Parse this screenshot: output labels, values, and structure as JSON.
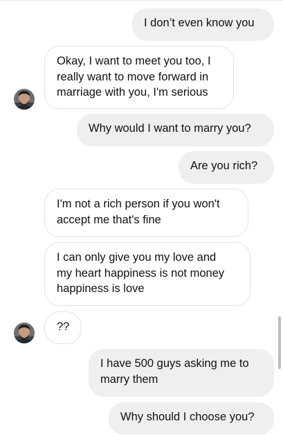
{
  "conversation": {
    "messages": [
      {
        "from": "me",
        "text": "I don’t even know you"
      },
      {
        "from": "them",
        "text": "Okay, I want to meet you too, I\nreally want to move forward in\nmarriage with you, I'm serious"
      },
      {
        "from": "me",
        "text": "Why would I want to marry you?"
      },
      {
        "from": "me",
        "text": "Are you rich?"
      },
      {
        "from": "them",
        "text": "I'm not a rich person if you won't\naccept me that's fine"
      },
      {
        "from": "them",
        "text": "I can only give you my love and\nmy heart happiness is not money\nhappiness is love"
      },
      {
        "from": "them",
        "text": "??"
      },
      {
        "from": "me",
        "text": "I have 500 guys asking me to\nmarry them"
      },
      {
        "from": "me",
        "text": "Why should I choose you?"
      }
    ]
  },
  "colors": {
    "sent_bubble": "#efefef",
    "received_border": "#e2e2e2",
    "text": "#111111"
  },
  "icons": {
    "avatar": "contact-avatar"
  }
}
